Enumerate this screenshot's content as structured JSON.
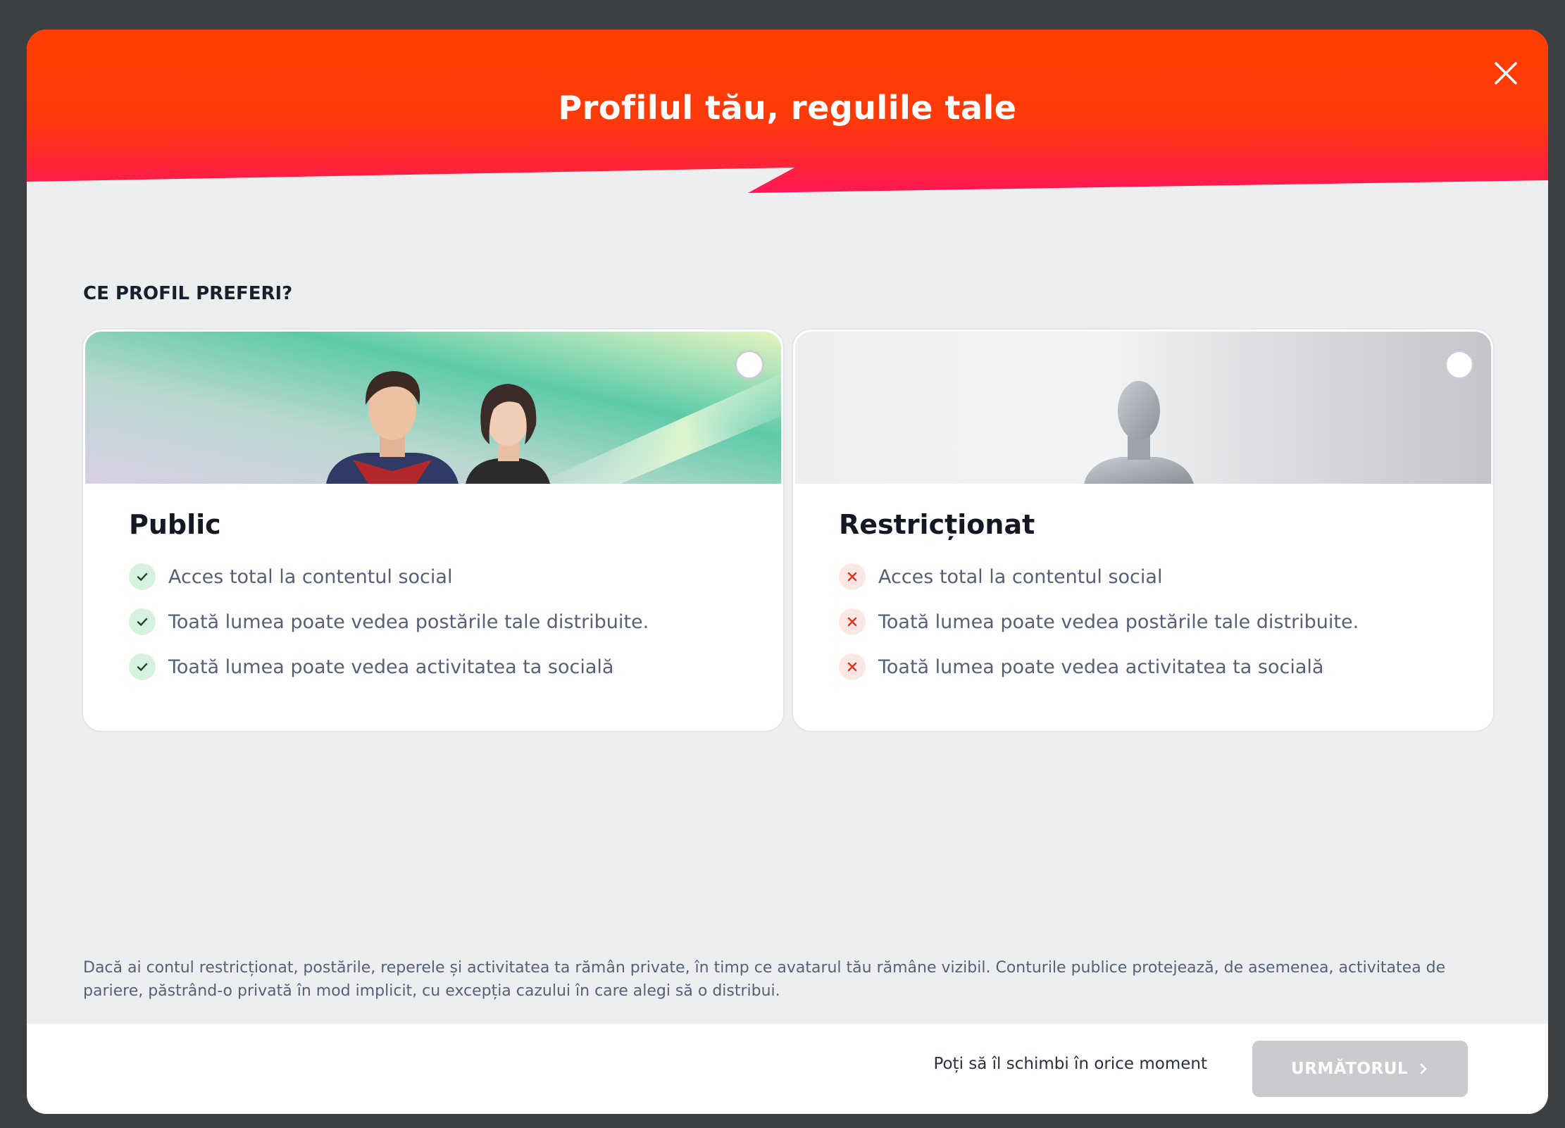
{
  "modal": {
    "title": "Profilul tău, regulile tale",
    "close_icon": "close-icon",
    "accent_top": "#ff3d00",
    "accent_bottom": "#ff1754"
  },
  "section": {
    "label": "CE PROFIL PREFERI?"
  },
  "options": [
    {
      "title": "Public",
      "selected": false,
      "features": [
        {
          "text": "Acces total la contentul social",
          "status": "check-icon"
        },
        {
          "text": "Toată lumea poate vedea postările tale distribuite.",
          "status": "check-icon"
        },
        {
          "text": "Toată lumea poate vedea activitatea ta socială",
          "status": "check-icon"
        }
      ]
    },
    {
      "title": "Restricționat",
      "selected": false,
      "features": [
        {
          "text": "Acces total la contentul social",
          "status": "cross-icon"
        },
        {
          "text": "Toată lumea poate vedea postările tale distribuite.",
          "status": "cross-icon"
        },
        {
          "text": "Toată lumea poate vedea activitatea ta socială",
          "status": "cross-icon"
        }
      ]
    }
  ],
  "disclaimer": "Dacă ai contul restricționat, postările, reperele și activitatea ta rămân private, în timp ce avatarul tău rămâne vizibil. Conturile publice protejează, de asemenea, activitatea de pariere, păstrând-o privată în mod implicit, cu excepția cazului în care alegi să o distribui.",
  "footer": {
    "note": "Poți să îl schimbi în orice moment",
    "next_label": "URMĂTORUL",
    "next_icon": "chevron-right-icon",
    "next_disabled": true
  }
}
